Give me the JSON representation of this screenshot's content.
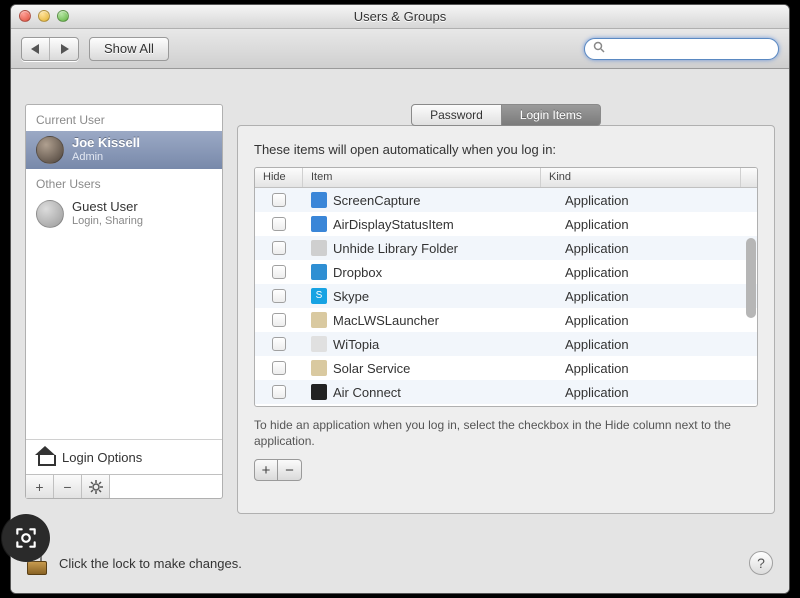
{
  "window": {
    "title": "Users & Groups"
  },
  "toolbar": {
    "show_all": "Show All",
    "search_placeholder": ""
  },
  "sidebar": {
    "current_label": "Current User",
    "other_label": "Other Users",
    "current": {
      "name": "Joe Kissell",
      "role": "Admin"
    },
    "others": [
      {
        "name": "Guest User",
        "role": "Login, Sharing"
      }
    ],
    "login_options": "Login Options"
  },
  "tabs": {
    "password": "Password",
    "login_items": "Login Items"
  },
  "panel": {
    "intro": "These items will open automatically when you log in:",
    "columns": {
      "hide": "Hide",
      "item": "Item",
      "kind": "Kind"
    },
    "rows": [
      {
        "name": "ScreenCapture",
        "kind": "Application",
        "icon_bg": "#3a86d8"
      },
      {
        "name": "AirDisplayStatusItem",
        "kind": "Application",
        "icon_bg": "#3a86d8"
      },
      {
        "name": "Unhide Library Folder",
        "kind": "Application",
        "icon_bg": "#cfcfcf"
      },
      {
        "name": "Dropbox",
        "kind": "Application",
        "icon_bg": "#2f8fd3"
      },
      {
        "name": "Skype",
        "kind": "Application",
        "icon_bg": "#17a3e3",
        "glyph": "S"
      },
      {
        "name": "MacLWSLauncher",
        "kind": "Application",
        "icon_bg": "#d9c9a0"
      },
      {
        "name": "WiTopia",
        "kind": "Application",
        "icon_bg": "#e0e0e0"
      },
      {
        "name": "Solar Service",
        "kind": "Application",
        "icon_bg": "#d9c9a0"
      },
      {
        "name": "Air Connect",
        "kind": "Application",
        "icon_bg": "#222222"
      }
    ],
    "hint": "To hide an application when you log in, select the checkbox in the Hide column next to the application."
  },
  "bottom": {
    "lock_text": "Click the lock to make changes."
  }
}
